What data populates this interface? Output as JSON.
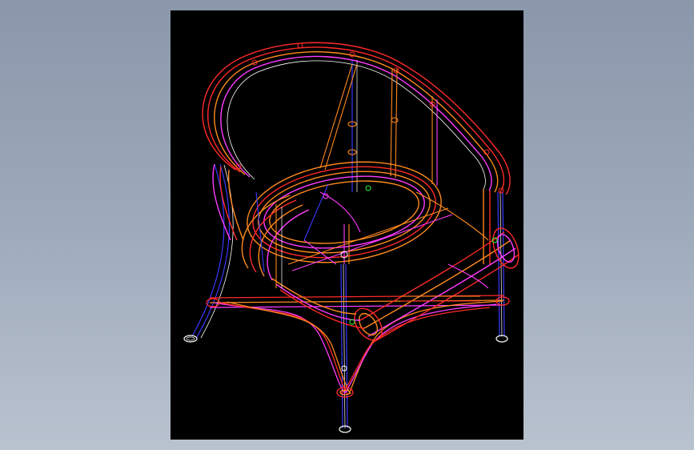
{
  "background": {
    "top": "#8a97aa",
    "bottom": "#b9c2cf"
  },
  "viewport": {
    "background": "#000000"
  },
  "colors": {
    "orange": "#ff8a1e",
    "red": "#ff2a2a",
    "magenta": "#ff3cff",
    "blue": "#3a3aff",
    "white": "#ffffff",
    "green": "#2cff2c"
  },
  "drawing": {
    "subject": "chair-wireframe-icon"
  }
}
